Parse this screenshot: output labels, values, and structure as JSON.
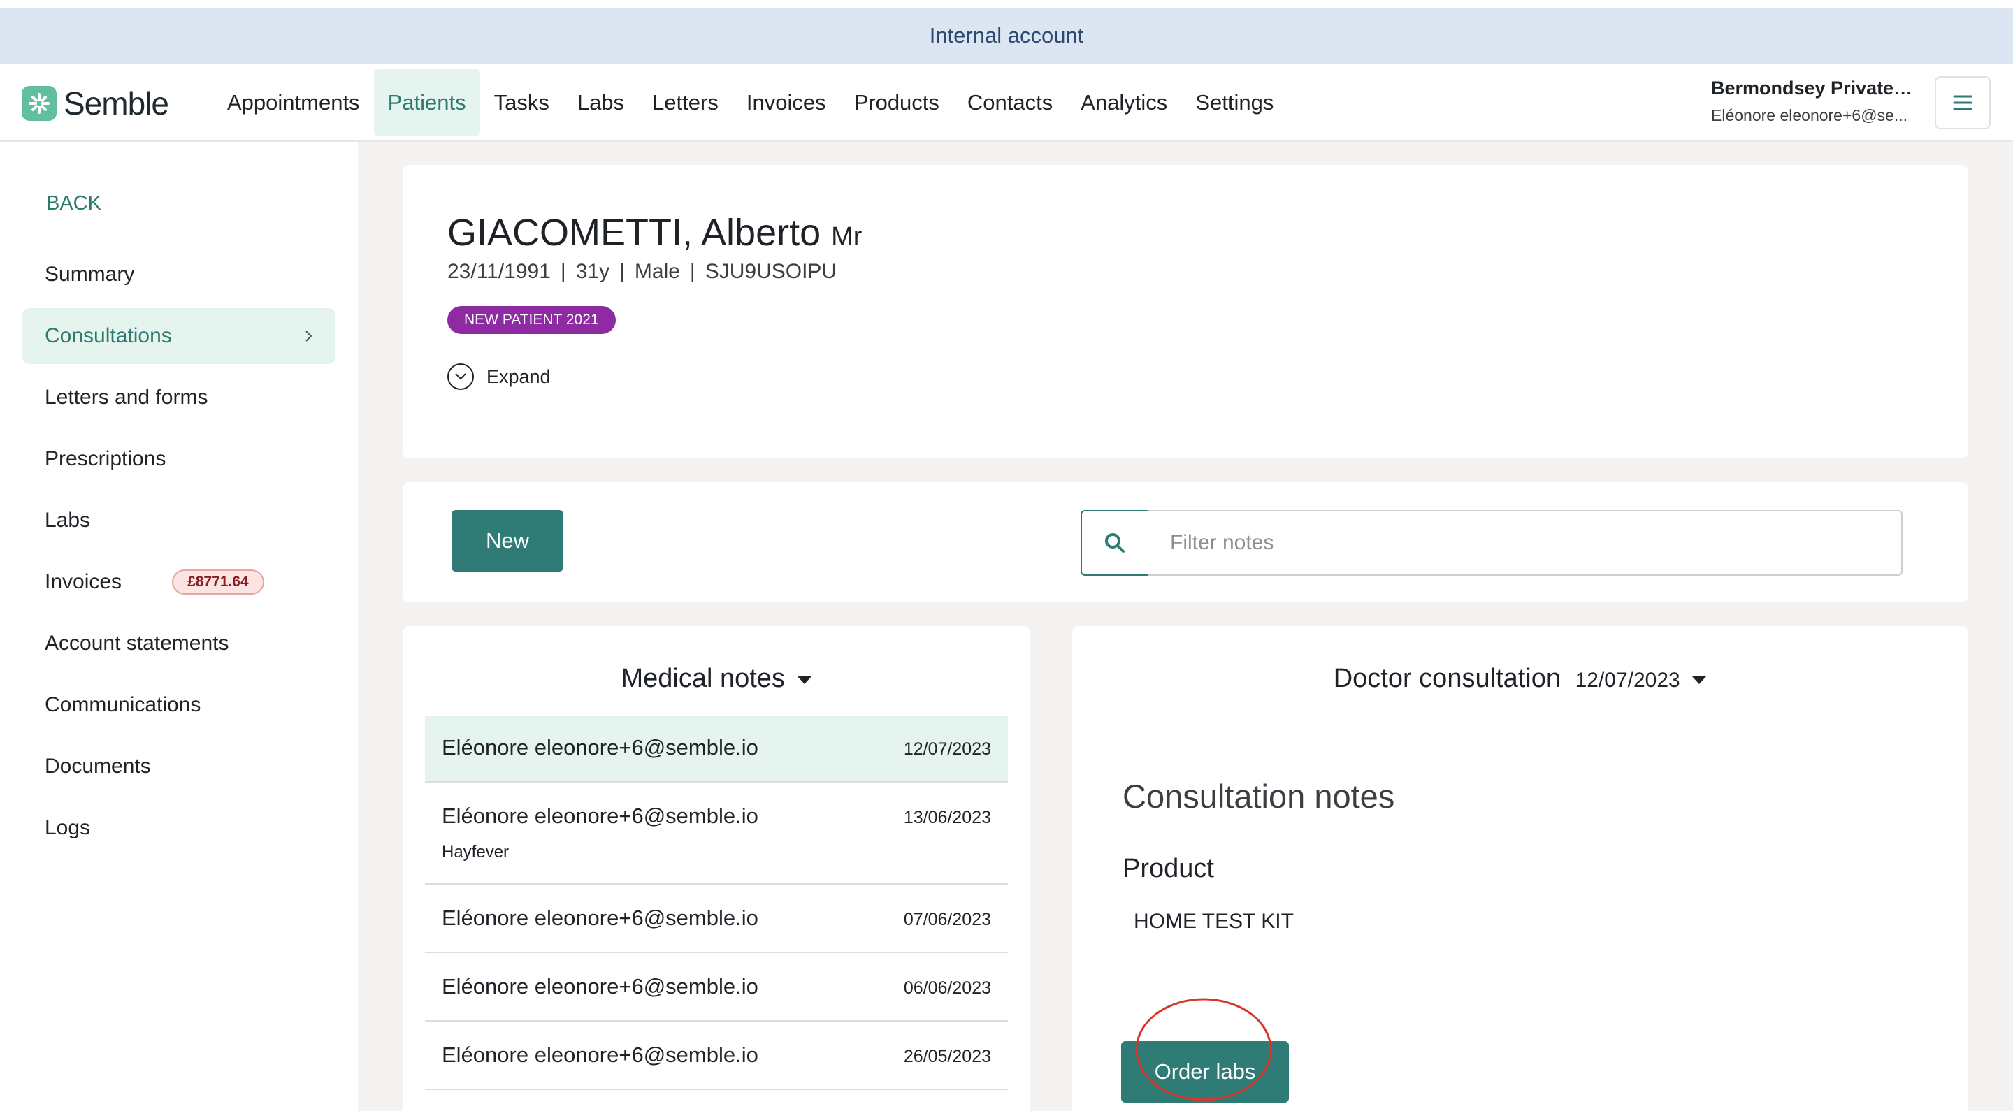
{
  "banner": {
    "text": "Internal account"
  },
  "app": {
    "name": "Semble"
  },
  "nav": {
    "items": [
      {
        "label": "Appointments",
        "active": false
      },
      {
        "label": "Patients",
        "active": true
      },
      {
        "label": "Tasks",
        "active": false
      },
      {
        "label": "Labs",
        "active": false
      },
      {
        "label": "Letters",
        "active": false
      },
      {
        "label": "Invoices",
        "active": false
      },
      {
        "label": "Products",
        "active": false
      },
      {
        "label": "Contacts",
        "active": false
      },
      {
        "label": "Analytics",
        "active": false
      },
      {
        "label": "Settings",
        "active": false
      }
    ]
  },
  "account": {
    "name": "Bermondsey Private ...",
    "email": "Eléonore eleonore+6@se..."
  },
  "sidebar": {
    "back_label": "BACK",
    "items": [
      {
        "label": "Summary"
      },
      {
        "label": "Consultations",
        "active": true
      },
      {
        "label": "Letters and forms"
      },
      {
        "label": "Prescriptions"
      },
      {
        "label": "Labs"
      },
      {
        "label": "Invoices",
        "badge": "£8771.64"
      },
      {
        "label": "Account statements"
      },
      {
        "label": "Communications"
      },
      {
        "label": "Documents"
      },
      {
        "label": "Logs"
      }
    ]
  },
  "patient": {
    "name": "GIACOMETTI, Alberto",
    "title": "Mr",
    "dob": "23/11/1991",
    "age": "31y",
    "sex": "Male",
    "id": "SJU9USOIPU",
    "tag": "NEW PATIENT 2021",
    "expand_label": "Expand"
  },
  "toolbar": {
    "new_label": "New",
    "filter_placeholder": "Filter notes"
  },
  "medical_notes": {
    "title": "Medical notes",
    "rows": [
      {
        "author": "Eléonore eleonore+6@semble.io",
        "date": "12/07/2023",
        "subtitle": "",
        "selected": true
      },
      {
        "author": "Eléonore eleonore+6@semble.io",
        "date": "13/06/2023",
        "subtitle": "Hayfever"
      },
      {
        "author": "Eléonore eleonore+6@semble.io",
        "date": "07/06/2023",
        "subtitle": ""
      },
      {
        "author": "Eléonore eleonore+6@semble.io",
        "date": "06/06/2023",
        "subtitle": ""
      },
      {
        "author": "Eléonore eleonore+6@semble.io",
        "date": "26/05/2023",
        "subtitle": ""
      }
    ]
  },
  "consultation": {
    "title": "Doctor consultation",
    "date": "12/07/2023",
    "heading": "Consultation notes",
    "product_label": "Product",
    "product_value": "HOME TEST KIT",
    "order_label": "Order labs"
  },
  "colors": {
    "accent": "#2f7b76",
    "active_bg": "#e6f4ef",
    "tag": "#8e2ba3",
    "annotation": "#d9352b"
  }
}
